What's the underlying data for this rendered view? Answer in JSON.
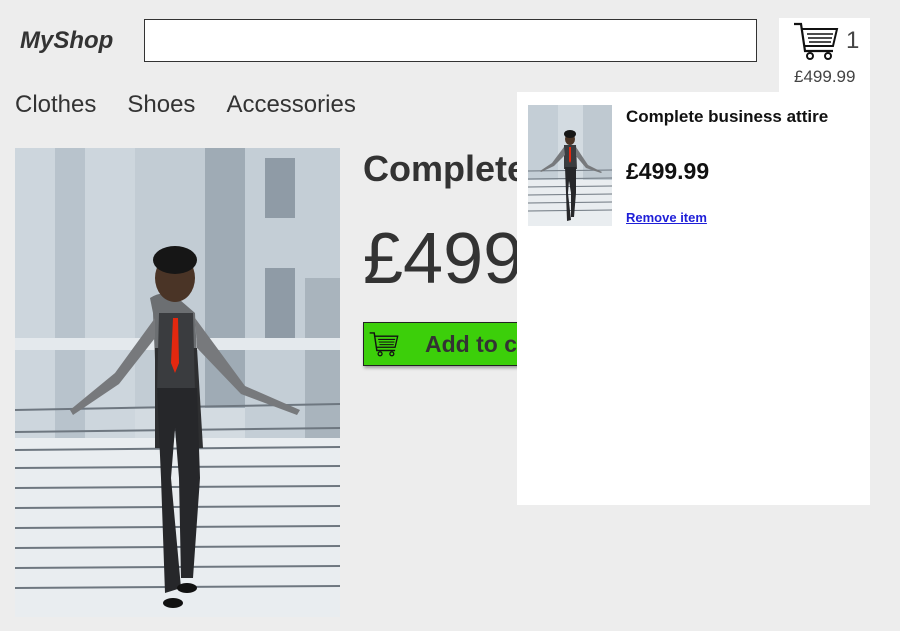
{
  "header": {
    "logo": "MyShop",
    "search": {
      "value": "",
      "placeholder": ""
    },
    "cart": {
      "count": "1",
      "total": "£499.99"
    }
  },
  "nav": {
    "items": [
      {
        "label": "Clothes"
      },
      {
        "label": "Shoes"
      },
      {
        "label": "Accessories"
      }
    ]
  },
  "product": {
    "title": "Complete business attire",
    "price": "£499.99",
    "add_to_cart_label": "Add to cart"
  },
  "cart_dropdown": {
    "items": [
      {
        "name": "Complete business attire",
        "price": "£499.99",
        "remove_label": "Remove item"
      }
    ]
  },
  "colors": {
    "background": "#ededed",
    "add_button": "#3ccf0a",
    "remove_link": "#1f1fd8"
  }
}
